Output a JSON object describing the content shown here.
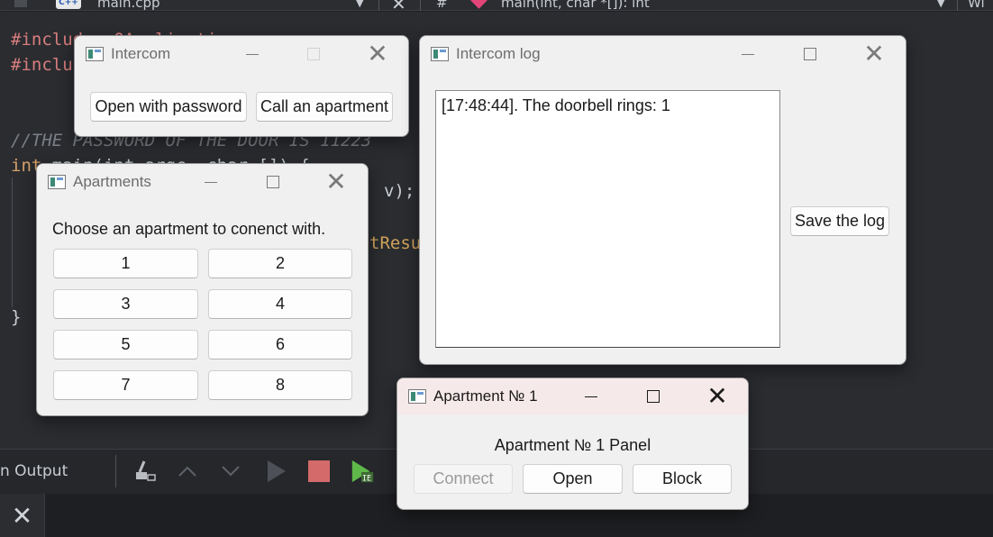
{
  "ide": {
    "file_tab": "main.cpp",
    "hash": "#",
    "function_sig": "main(int, char *[]): int",
    "right_label": "Wi",
    "cpp_badge": "C++",
    "code_line_1": "#inclu",
    "code_line_1b": "de <QApplicati",
    "code_line_2": "#inclu",
    "code_comment": "//THE PASSWORD OF THE DOOR IS 11223",
    "code_int": "int",
    "code_main": " main(int argc, char ",
    "code_brace_open": "[]) {",
    "code_v": "v);",
    "code_result": "tResu",
    "code_close": "}",
    "output_label": "n Output",
    "close_glyph": "✕"
  },
  "intercom": {
    "title": "Intercom",
    "open_with_password": "Open with password",
    "call_apartment": "Call an apartment"
  },
  "intercom_log": {
    "title": "Intercom log",
    "log_lines": [
      "[17:48:44]. The doorbell rings: 1"
    ],
    "save_button": "Save the log"
  },
  "apartments": {
    "title": "Apartments",
    "prompt": "Choose an apartment to  conenct with.",
    "buttons": [
      "1",
      "2",
      "3",
      "4",
      "5",
      "6",
      "7",
      "8"
    ]
  },
  "apartment_panel": {
    "title": "Apartment № 1",
    "heading": "Apartment № 1 Panel",
    "connect": "Connect",
    "open": "Open",
    "block": "Block"
  },
  "icons": {
    "close": "✕"
  }
}
